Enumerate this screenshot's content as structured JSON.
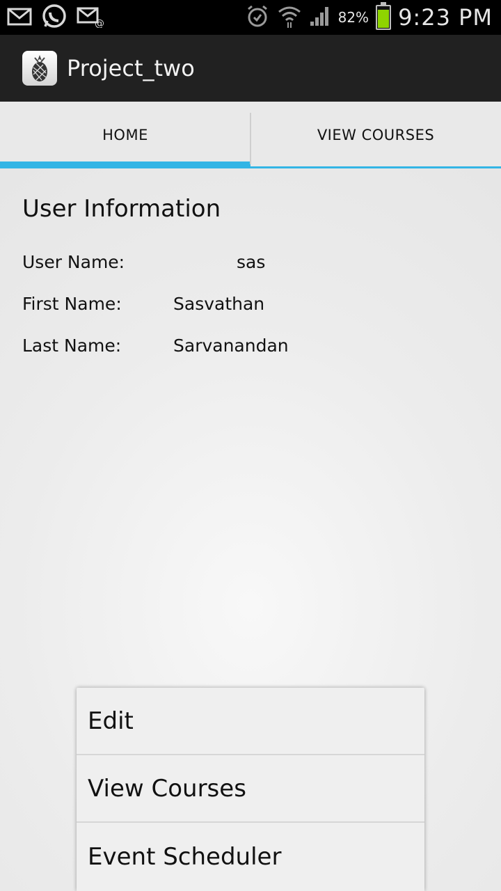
{
  "status_bar": {
    "left_icons": [
      "gmail-icon",
      "whatsapp-icon",
      "email-icon"
    ],
    "right_icons": [
      "alarm-icon",
      "wifi-icon",
      "signal-icon",
      "battery-icon"
    ],
    "battery_percent": "82%",
    "battery_level": 0.82,
    "time": "9:23 PM",
    "battery_color": "#8fd400"
  },
  "action_bar": {
    "app_icon": "pineapple-icon",
    "title": "Project_two"
  },
  "tabs": [
    {
      "label": "HOME",
      "active": true
    },
    {
      "label": "VIEW COURSES",
      "active": false
    }
  ],
  "accent_color": "#33b5e5",
  "user_info": {
    "title": "User Information",
    "rows": [
      {
        "label": "User Name:",
        "value": "sas"
      },
      {
        "label": "First Name:",
        "value": "Sasvathan"
      },
      {
        "label": "Last Name:",
        "value": "Sarvanandan"
      }
    ]
  },
  "menu": {
    "items": [
      "Edit",
      "View Courses",
      "Event Scheduler"
    ]
  }
}
